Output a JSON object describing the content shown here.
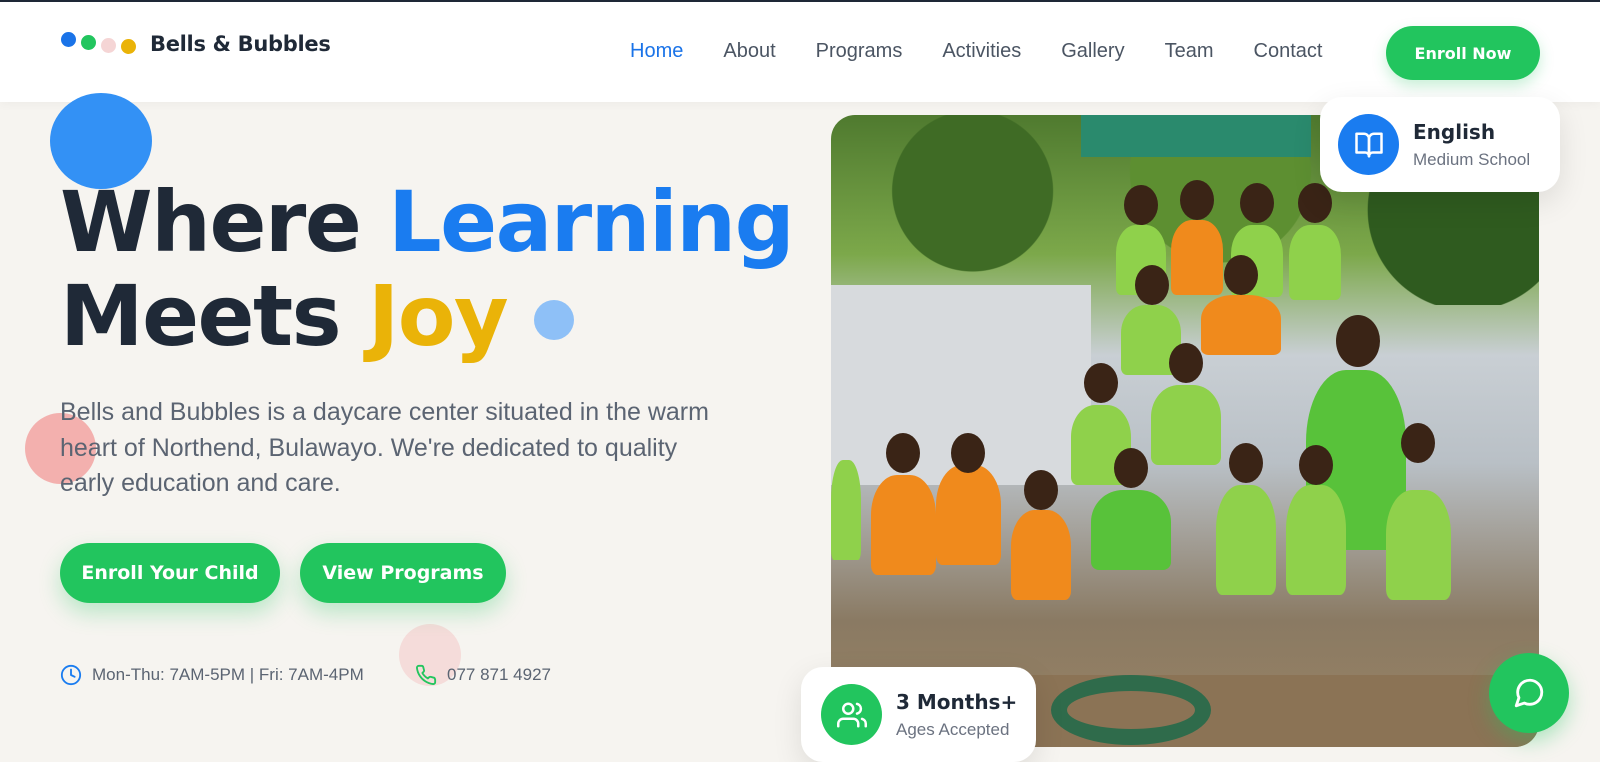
{
  "brand": {
    "name": "Bells & Bubbles",
    "dot_colors": [
      "#1a73e8",
      "#22c55e",
      "#f5d5d5",
      "#eab308"
    ]
  },
  "nav": {
    "items": [
      {
        "label": "Home",
        "active": true
      },
      {
        "label": "About",
        "active": false
      },
      {
        "label": "Programs",
        "active": false
      },
      {
        "label": "Activities",
        "active": false
      },
      {
        "label": "Gallery",
        "active": false
      },
      {
        "label": "Team",
        "active": false
      },
      {
        "label": "Contact",
        "active": false
      }
    ],
    "cta_label": "Enroll Now"
  },
  "hero": {
    "title_part1": "Where ",
    "title_highlight1": "Learning",
    "title_part2": "Meets ",
    "title_highlight2": "Joy",
    "description": "Bells and Bubbles is a daycare center situated in the warm heart of Northend, Bulawayo. We're dedicated to quality early education and care.",
    "primary_button": "Enroll Your Child",
    "secondary_button": "View Programs",
    "hours": "Mon-Thu: 7AM-5PM | Fri: 7AM-4PM",
    "phone": "077 871 4927"
  },
  "cards": {
    "language_title": "English",
    "language_sub": "Medium School",
    "ages_title": "3 Months+",
    "ages_sub": "Ages Accepted"
  },
  "icons": {
    "hours": "clock-icon",
    "phone": "phone-icon",
    "language": "book-open-icon",
    "ages": "users-icon",
    "chat": "chat-bubble-icon"
  },
  "colors": {
    "primary_blue": "#1a7cf0",
    "accent_yellow": "#eab308",
    "primary_green": "#22c55e",
    "dark_text": "#1f2937",
    "background": "#f6f4f0"
  }
}
